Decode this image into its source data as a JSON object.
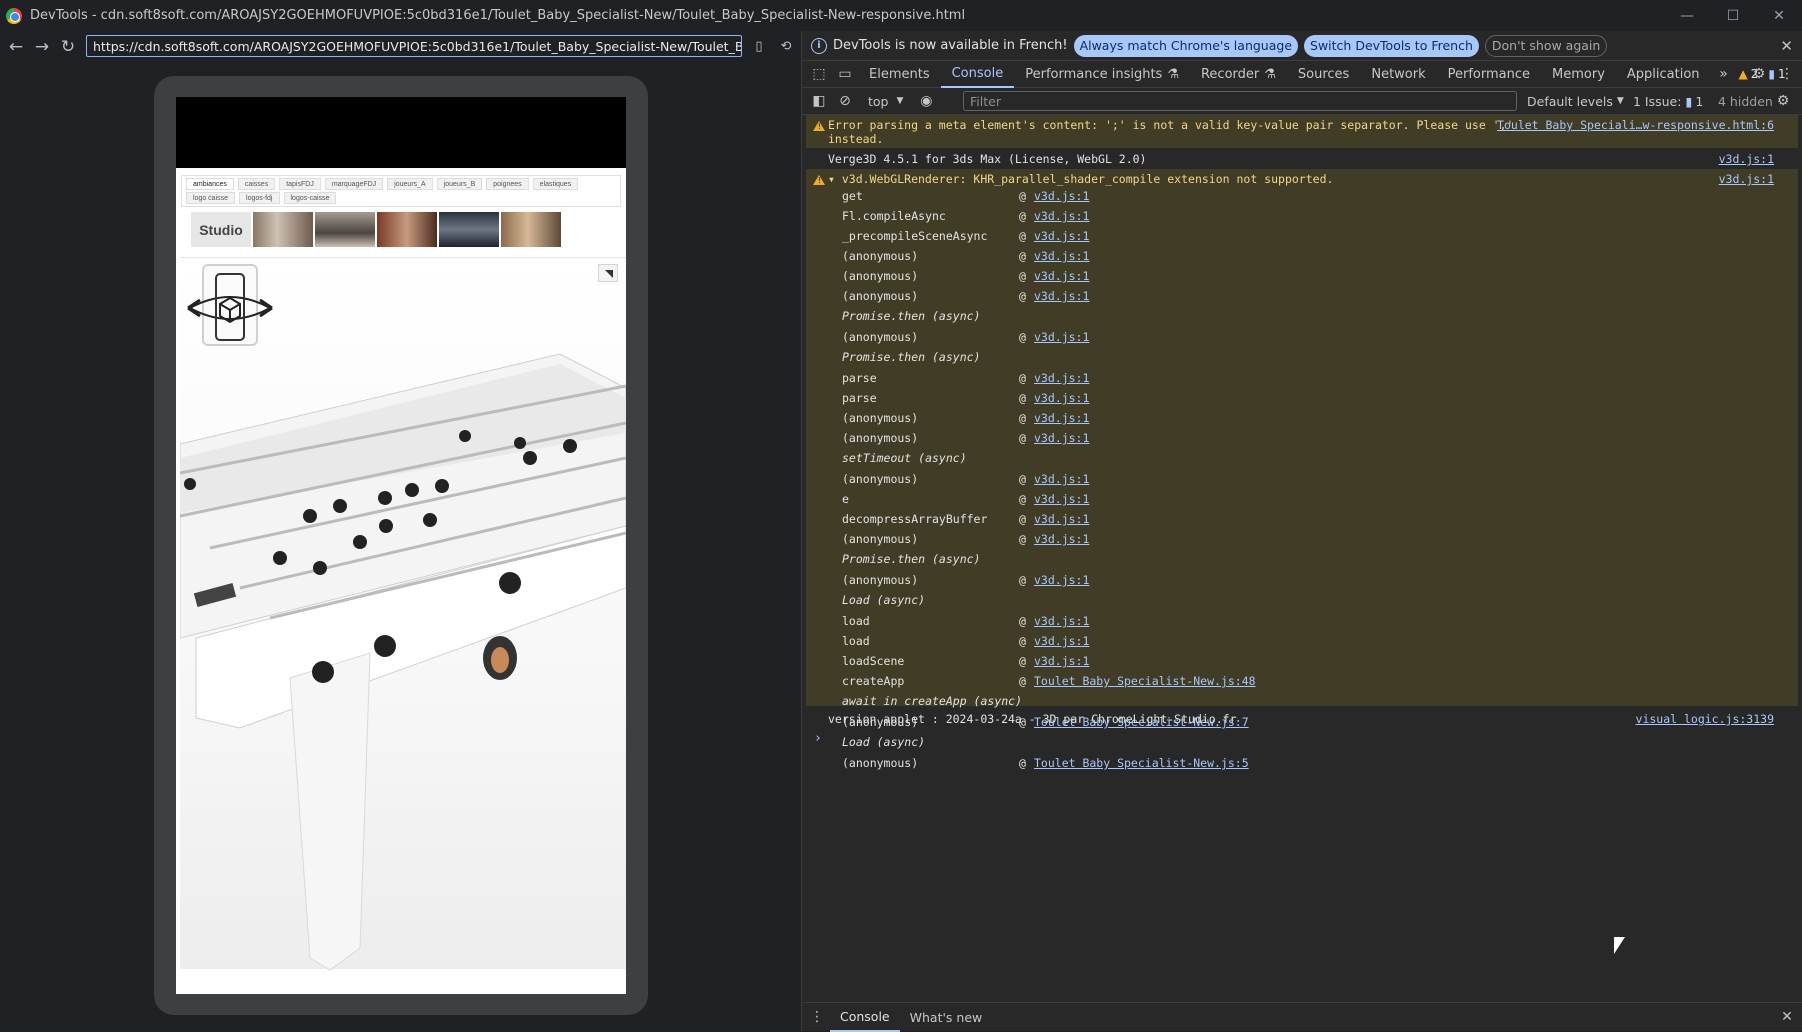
{
  "window": {
    "title": "DevTools - cdn.soft8soft.com/AROAJSY2GOEHMOFUVPIOE:5c0bd316e1/Toulet_Baby_Specialist-New/Toulet_Baby_Specialist-New-responsive.html",
    "minimize": "—",
    "maximize": "☐",
    "close": "✕"
  },
  "address": {
    "url": "https://cdn.soft8soft.com/AROAJSY2GOEHMOFUVPIOE:5c0bd316e1/Toulet_Baby_Specialist-New/Toulet_Baby_Specialist-N"
  },
  "page": {
    "tabs": [
      "ambiances",
      "caisses",
      "tapisFDJ",
      "marquageFDJ",
      "joueurs_A",
      "joueurs_B",
      "poignees",
      "elastiques",
      "logo caisse",
      "logos-fdj",
      "logos-caisse"
    ],
    "studio_label": "Studio"
  },
  "infobar": {
    "message": "DevTools is now available in French!",
    "btn_match": "Always match Chrome's language",
    "btn_switch": "Switch DevTools to French",
    "btn_dont_show": "Don't show again"
  },
  "tabs": {
    "elements": "Elements",
    "console": "Console",
    "perf_insights": "Performance insights",
    "recorder": "Recorder",
    "sources": "Sources",
    "network": "Network",
    "performance": "Performance",
    "memory": "Memory",
    "application": "Application",
    "warn_count": "2",
    "msg_count": "1"
  },
  "toolbar": {
    "context": "top",
    "filter_placeholder": "Filter",
    "levels": "Default levels",
    "issues": "1 Issue:",
    "issues_count": "1",
    "hidden": "4 hidden"
  },
  "console": {
    "warn1": {
      "line1": "Error parsing a meta element's content: ';' is not a valid key-value pair separator. Please use ','",
      "line2": "instead.",
      "source": "Toulet Baby Speciali…w-responsive.html:6"
    },
    "info1": {
      "text": "Verge3D 4.5.1 for 3ds Max (License, WebGL 2.0)",
      "source": "v3d.js:1"
    },
    "warn2": {
      "text": "▾ v3d.WebGLRenderer: KHR_parallel_shader_compile extension not supported.",
      "source": "v3d.js:1",
      "frames": [
        {
          "fn": "get",
          "src": "v3d.js:1"
        },
        {
          "fn": "Fl.compileAsync",
          "src": "v3d.js:1"
        },
        {
          "fn": "_precompileSceneAsync",
          "src": "v3d.js:1"
        },
        {
          "fn": "(anonymous)",
          "src": "v3d.js:1"
        },
        {
          "fn": "(anonymous)",
          "src": "v3d.js:1"
        },
        {
          "fn": "(anonymous)",
          "src": "v3d.js:1"
        },
        {
          "fn": "Promise.then (async)",
          "src": ""
        },
        {
          "fn": "(anonymous)",
          "src": "v3d.js:1"
        },
        {
          "fn": "Promise.then (async)",
          "src": ""
        },
        {
          "fn": "parse",
          "src": "v3d.js:1"
        },
        {
          "fn": "parse",
          "src": "v3d.js:1"
        },
        {
          "fn": "(anonymous)",
          "src": "v3d.js:1"
        },
        {
          "fn": "(anonymous)",
          "src": "v3d.js:1"
        },
        {
          "fn": "setTimeout (async)",
          "src": ""
        },
        {
          "fn": "(anonymous)",
          "src": "v3d.js:1"
        },
        {
          "fn": "e",
          "src": "v3d.js:1"
        },
        {
          "fn": "decompressArrayBuffer",
          "src": "v3d.js:1"
        },
        {
          "fn": "(anonymous)",
          "src": "v3d.js:1"
        },
        {
          "fn": "Promise.then (async)",
          "src": ""
        },
        {
          "fn": "(anonymous)",
          "src": "v3d.js:1"
        },
        {
          "fn": "Load (async)",
          "src": ""
        },
        {
          "fn": "load",
          "src": "v3d.js:1"
        },
        {
          "fn": "load",
          "src": "v3d.js:1"
        },
        {
          "fn": "loadScene",
          "src": "v3d.js:1"
        },
        {
          "fn": "createApp",
          "src": "Toulet Baby Specialist-New.js:48"
        },
        {
          "fn": "await in createApp (async)",
          "src": ""
        },
        {
          "fn": "(anonymous)",
          "src": "Toulet Baby Specialist-New.js:7"
        },
        {
          "fn": "Load (async)",
          "src": ""
        },
        {
          "fn": "(anonymous)",
          "src": "Toulet Baby Specialist-New.js:5"
        }
      ]
    },
    "info2": {
      "text": "version applet : 2024-03-24a - 3D par ChromeLight-Studio.fr",
      "source": "visual logic.js:3139"
    },
    "prompt": "›"
  },
  "drawer": {
    "console": "Console",
    "whats_new": "What's new"
  }
}
